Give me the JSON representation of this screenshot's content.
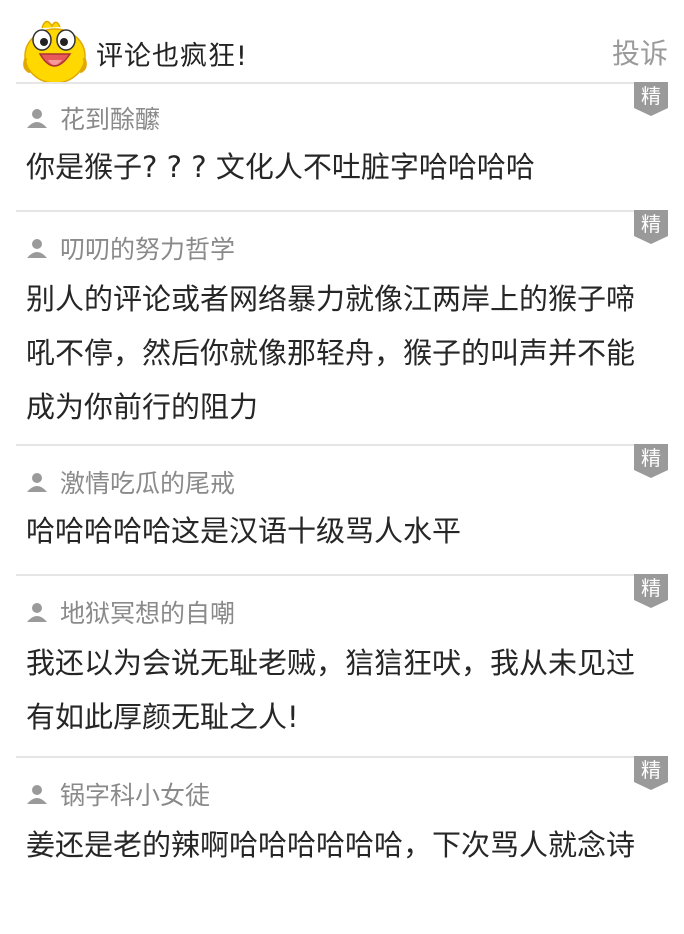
{
  "header": {
    "title": "评论也疯狂!",
    "report_label": "投诉",
    "mascot_icon": "yellow-duck-mascot-icon"
  },
  "badge_label": "精",
  "colors": {
    "badge": "#9a9a9a",
    "author": "#8a8a8a",
    "text": "#262626",
    "divider": "#e6e6e6",
    "report": "#9a9a9a",
    "mascot_yellow": "#ffd800"
  },
  "comments": [
    {
      "author": "花到酴醿",
      "text": "你是猴子? ? ? 文化人不吐脏字哈哈哈哈"
    },
    {
      "author": "叨叨的努力哲学",
      "text": "别人的评论或者网络暴力就像江两岸上的猴子啼吼不停，然后你就像那轻舟，猴子的叫声并不能成为你前行的阻力"
    },
    {
      "author": "激情吃瓜的尾戒",
      "text": "哈哈哈哈哈这是汉语十级骂人水平"
    },
    {
      "author": "地狱冥想的自嘲",
      "text": "我还以为会说无耻老贼，狺狺狂吠，我从未见过有如此厚颜无耻之人!"
    },
    {
      "author": "锅字科小女徒",
      "text": "姜还是老的辣啊哈哈哈哈哈哈，下次骂人就念诗"
    }
  ]
}
